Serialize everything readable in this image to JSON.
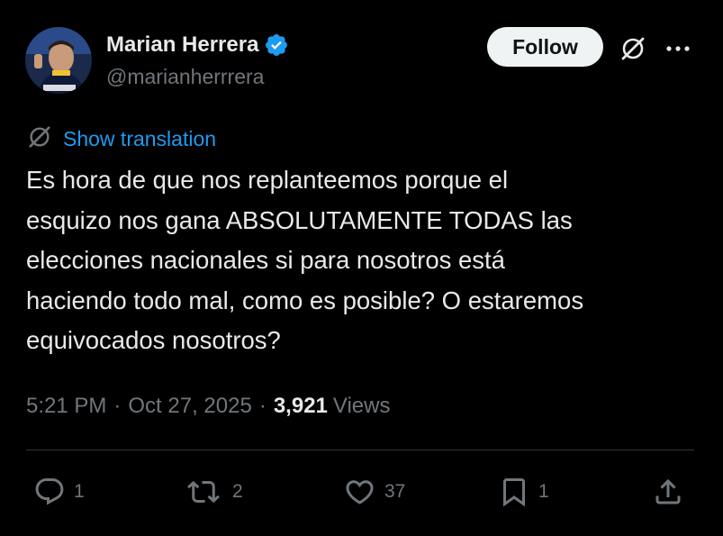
{
  "author": {
    "name": "Marian Herrera",
    "handle": "@marianherrrera",
    "verified": true,
    "avatar_icon": "profile-photo"
  },
  "header": {
    "follow_label": "Follow",
    "grok_icon": "grok-icon",
    "more_icon": "more-icon"
  },
  "translation": {
    "label": "Show translation",
    "icon": "grok-icon"
  },
  "tweet": {
    "lines": [
      "Es hora de que nos replanteemos porque el",
      "esquizo nos gana ABSOLUTAMENTE TODAS las",
      "elecciones nacionales si para nosotros está",
      "haciendo todo mal, como es posible? O estaremos",
      "equivocados nosotros?"
    ]
  },
  "meta": {
    "time": "5:21 PM",
    "separator": "·",
    "date": "Oct 27, 2025",
    "views_count": "3,921",
    "views_label": "Views"
  },
  "actions": {
    "reply": {
      "count": "1",
      "icon": "reply-icon"
    },
    "repost": {
      "count": "2",
      "icon": "repost-icon"
    },
    "like": {
      "count": "37",
      "icon": "heart-icon"
    },
    "bookmark": {
      "count": "1",
      "icon": "bookmark-icon"
    },
    "share": {
      "icon": "share-icon"
    }
  },
  "colors": {
    "background": "#000000",
    "text_primary": "#e7e9ea",
    "text_secondary": "#71767b",
    "link": "#1d9bf0",
    "verified_badge": "#1d9bf0",
    "divider": "#2f3336",
    "follow_button_bg": "#eff3f4",
    "follow_button_text": "#0f1419"
  }
}
